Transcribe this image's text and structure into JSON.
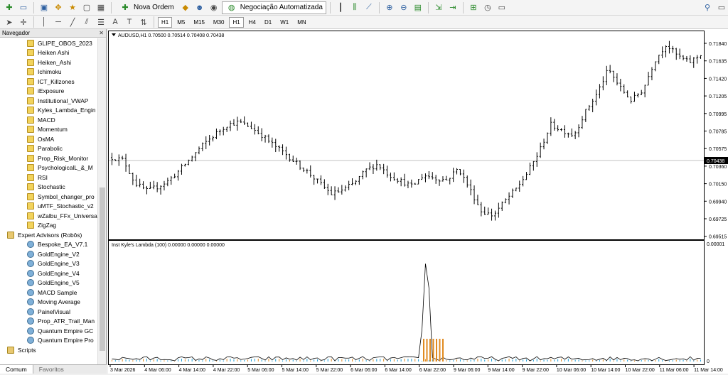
{
  "toolbar": {
    "new_order_label": "Nova Ordem",
    "algo_trading_label": "Negociação Automatizada",
    "timeframes": [
      "H1",
      "M5",
      "M15",
      "M30",
      "H1",
      "H4",
      "D1",
      "W1",
      "MN"
    ],
    "active_timeframe": "H1"
  },
  "navigator": {
    "title": "Navegador",
    "indicators": [
      "GLIPE_OBOS_2023",
      "Heiken Ashi",
      "Heiken_Ashi",
      "Ichimoku",
      "ICT_Killzones",
      "iExposure",
      "Institutional_VWAP",
      "Kyles_Lambda_Engin",
      "MACD",
      "Momentum",
      "OsMA",
      "Parabolic",
      "Prop_Risk_Monitor",
      "PsychologicalL_&_M",
      "RSI",
      "Stochastic",
      "Symbol_changer_pro",
      "uMTF_Stochastic_v2",
      "wZalbu_FFx_Universa",
      "ZigZag"
    ],
    "expert_advisors_label": "Expert Advisors (Robôs)",
    "experts": [
      "Bespoke_EA_V7.1",
      "GoldEngine_V2",
      "GoldEngine_V3",
      "GoldEngine_V4",
      "GoldEngine_V5",
      "MACD Sample",
      "Moving Average",
      "PainelVisual",
      "Prop_ATR_Trail_Man",
      "Quantum Empire GC",
      "Quantum Empire Pro"
    ],
    "scripts_label": "Scripts",
    "tabs": [
      "Comum",
      "Favoritos"
    ]
  },
  "chart": {
    "header": "AUDUSD,H1  0.70500 0.70514 0.70408 0.70438",
    "current_price": "0.70438",
    "price_ticks": [
      "0.71840",
      "0.71635",
      "0.71420",
      "0.71205",
      "0.70995",
      "0.70785",
      "0.70575",
      "0.70360",
      "0.70150",
      "0.69940",
      "0.69725",
      "0.69515"
    ],
    "time_ticks": [
      "3 Mar 2026",
      "4 Mar 06:00",
      "4 Mar 14:00",
      "4 Mar 22:00",
      "5 Mar 06:00",
      "5 Mar 14:00",
      "5 Mar 22:00",
      "6 Mar 06:00",
      "6 Mar 14:00",
      "6 Mar 22:00",
      "9 Mar 06:00",
      "9 Mar 14:00",
      "9 Mar 22:00",
      "10 Mar 06:00",
      "10 Mar 14:00",
      "10 Mar 22:00",
      "11 Mar 06:00",
      "11 Mar 14:00"
    ],
    "indicator_header": "Inst Kyle's Lambda (100) 0.00000 0.00000 0.00000",
    "indicator_max": "0.00001",
    "indicator_zero": "0"
  },
  "chart_data": {
    "type": "bar",
    "title": "AUDUSD,H1",
    "price_close_sequence": [
      0.7043,
      0.704,
      0.7012,
      0.7003,
      0.7008,
      0.7016,
      0.703,
      0.7045,
      0.706,
      0.7072,
      0.7083,
      0.7086,
      0.708,
      0.707,
      0.7058,
      0.7048,
      0.7036,
      0.7025,
      0.7012,
      0.6999,
      0.7004,
      0.7012,
      0.7028,
      0.7035,
      0.7022,
      0.7015,
      0.7008,
      0.7022,
      0.7018,
      0.7016,
      0.703,
      0.7005,
      0.6978,
      0.6973,
      0.699,
      0.7005,
      0.7025,
      0.705,
      0.7083,
      0.7076,
      0.707,
      0.7098,
      0.712,
      0.715,
      0.7128,
      0.7112,
      0.7125,
      0.716,
      0.718,
      0.7166,
      0.7158,
      0.7168
    ],
    "price_ylim": [
      0.6945,
      0.7195
    ],
    "lambda_peak": 1e-05
  }
}
